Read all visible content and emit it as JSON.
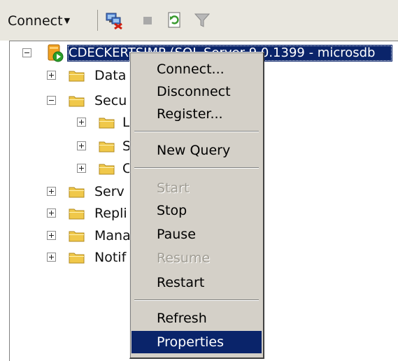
{
  "toolbar": {
    "connect_label": "Connect",
    "icons": [
      "connect-object-explorer-icon",
      "stop-icon",
      "refresh-icon",
      "filter-icon"
    ]
  },
  "tree": {
    "server_label": "CDECKERTSIMP (SQL Server 9.0.1399 - microsdb",
    "items": [
      {
        "label": "Data",
        "expander": "plus"
      },
      {
        "label": "Secu",
        "expander": "minus"
      },
      {
        "label": "L",
        "expander": "plus"
      },
      {
        "label": "S",
        "expander": "plus"
      },
      {
        "label": "C",
        "expander": "plus"
      },
      {
        "label": "Serv",
        "expander": "plus"
      },
      {
        "label": "Repli",
        "expander": "plus"
      },
      {
        "label": "Mana",
        "expander": "plus"
      },
      {
        "label": "Notif",
        "expander": "plus"
      }
    ]
  },
  "context_menu": {
    "items": [
      {
        "label": "Connect...",
        "enabled": true
      },
      {
        "label": "Disconnect",
        "enabled": true
      },
      {
        "label": "Register...",
        "enabled": true
      },
      {
        "label": "New Query",
        "enabled": true
      },
      {
        "label": "Start",
        "enabled": false
      },
      {
        "label": "Stop",
        "enabled": true
      },
      {
        "label": "Pause",
        "enabled": true
      },
      {
        "label": "Resume",
        "enabled": false
      },
      {
        "label": "Restart",
        "enabled": true
      },
      {
        "label": "Refresh",
        "enabled": true
      },
      {
        "label": "Properties",
        "enabled": true,
        "highlighted": true
      }
    ]
  },
  "colors": {
    "selection": "#0a246a",
    "menu_background": "#d4d0c8",
    "toolbar_background": "#e9e7df",
    "folder": "#f0c84a"
  }
}
